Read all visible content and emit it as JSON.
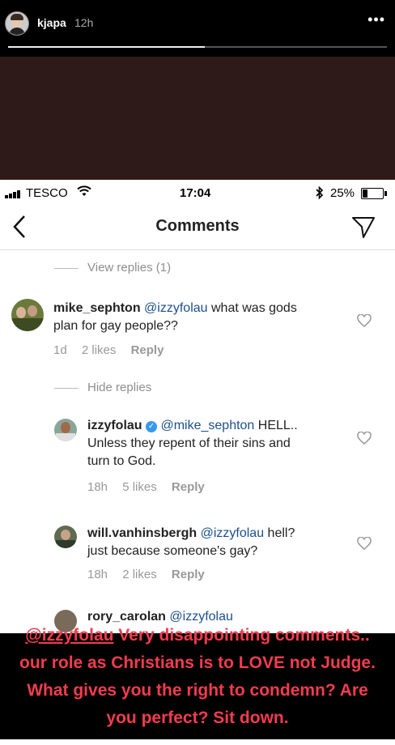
{
  "story": {
    "username": "kjapa",
    "time": "12h",
    "more": "•••",
    "progress": 0.52
  },
  "status_bar": {
    "carrier": "TESCO",
    "time": "17:04",
    "battery": "25%",
    "battery_level": 0.25
  },
  "nav": {
    "back": "‹",
    "title": "Comments"
  },
  "comments": {
    "view_replies": "View replies (1)",
    "hide_replies": "Hide replies",
    "c1": {
      "user": "mike_sephton",
      "mention": "@izzyfolau",
      "text_line1": " what was gods",
      "text_line2": "plan for gay people??",
      "age": "1d",
      "likes": "2 likes",
      "reply": "Reply"
    },
    "c2": {
      "user": "izzyfolau",
      "mention": "@mike_sephton",
      "text_line1": " HELL..",
      "text_line2": "Unless they repent of their sins and",
      "text_line3": "turn to God.",
      "age": "18h",
      "likes": "5 likes",
      "reply": "Reply"
    },
    "c3": {
      "user": "will.vanhinsbergh",
      "mention": "@izzyfolau",
      "text_line1": " hell?",
      "text_line2": "just because someone's gay?",
      "age": "18h",
      "likes": "2 likes",
      "reply": "Reply"
    },
    "c4": {
      "user": "rory_carolan",
      "mention": "@izzyfolau"
    }
  },
  "caption": {
    "mention": "@izzyfolau",
    "line1": " Very disappointing comments..",
    "line2": "our role as Christians is to LOVE not Judge.",
    "line3": "What gives you the right to condemn? Are",
    "line4": "you perfect? Sit down."
  }
}
